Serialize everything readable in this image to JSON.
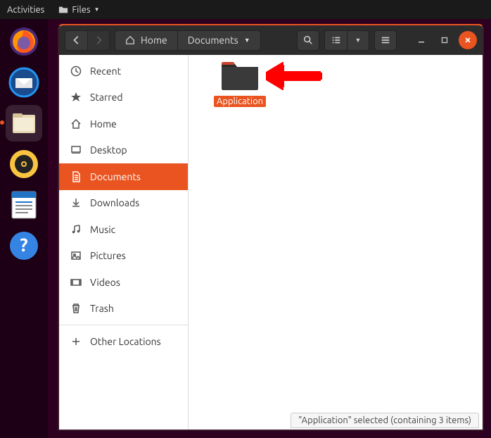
{
  "topbar": {
    "activities": "Activities",
    "files": "Files"
  },
  "path": {
    "home": "Home",
    "current": "Documents"
  },
  "sidebar": {
    "items": [
      {
        "label": "Recent"
      },
      {
        "label": "Starred"
      },
      {
        "label": "Home"
      },
      {
        "label": "Desktop"
      },
      {
        "label": "Documents"
      },
      {
        "label": "Downloads"
      },
      {
        "label": "Music"
      },
      {
        "label": "Pictures"
      },
      {
        "label": "Videos"
      },
      {
        "label": "Trash"
      }
    ],
    "other": "Other Locations"
  },
  "folder": {
    "name": "Application"
  },
  "status": "\"Application\" selected  (containing 3 items)"
}
